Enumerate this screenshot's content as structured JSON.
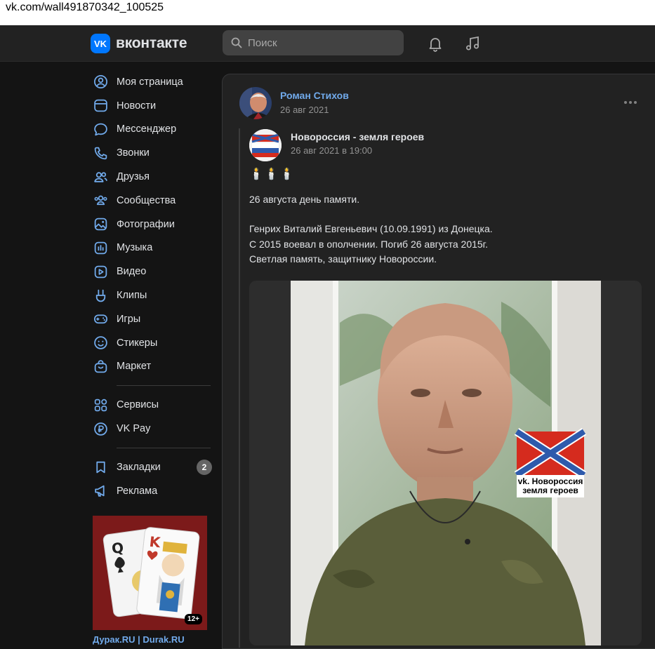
{
  "browser": {
    "url": "vk.com/wall491870342_100525"
  },
  "header": {
    "logo_badge": "VK",
    "logo_text": "вконтакте",
    "search_placeholder": "Поиск"
  },
  "sidebar": {
    "items": [
      {
        "label": "Моя страница",
        "icon": "profile-icon"
      },
      {
        "label": "Новости",
        "icon": "news-icon"
      },
      {
        "label": "Мессенджер",
        "icon": "messenger-icon"
      },
      {
        "label": "Звонки",
        "icon": "phone-icon"
      },
      {
        "label": "Друзья",
        "icon": "friends-icon"
      },
      {
        "label": "Сообщества",
        "icon": "communities-icon"
      },
      {
        "label": "Фотографии",
        "icon": "photos-icon"
      },
      {
        "label": "Музыка",
        "icon": "music-icon"
      },
      {
        "label": "Видео",
        "icon": "video-icon"
      },
      {
        "label": "Клипы",
        "icon": "clips-icon"
      },
      {
        "label": "Игры",
        "icon": "games-icon"
      },
      {
        "label": "Стикеры",
        "icon": "stickers-icon"
      },
      {
        "label": "Маркет",
        "icon": "market-icon"
      }
    ],
    "services": [
      {
        "label": "Сервисы",
        "icon": "services-icon"
      },
      {
        "label": "VK Pay",
        "icon": "vkpay-icon"
      }
    ],
    "extra": [
      {
        "label": "Закладки",
        "icon": "bookmarks-icon",
        "count": "2"
      },
      {
        "label": "Реклама",
        "icon": "ads-icon"
      }
    ],
    "ad": {
      "title": "Дурак.RU | Durak.RU",
      "age": "12+"
    }
  },
  "post": {
    "author": "Роман Стихов",
    "date": "26 авг 2021",
    "repost": {
      "source": "Новороссия - земля героев",
      "date": "26 авг 2021 в 19:00",
      "candles": "🕯️🕯️🕯️",
      "paragraph1": "26 августа день памяти.",
      "line1": "Генрих Виталий Евгеньевич (10.09.1991) из Донецка.",
      "line2": "С 2015 воевал в ополчении. Погиб 26 августа 2015г.",
      "line3": "Светлая память, защитнику Новороссии.",
      "photo_caption_1": "vk. Новороссия",
      "photo_caption_2": "земля героев"
    }
  },
  "colors": {
    "accent": "#0077ff",
    "link": "#71aaeb",
    "background": "#141414",
    "panel": "#222222",
    "flag_red": "#d52b1e",
    "flag_blue": "#2e5aac"
  }
}
